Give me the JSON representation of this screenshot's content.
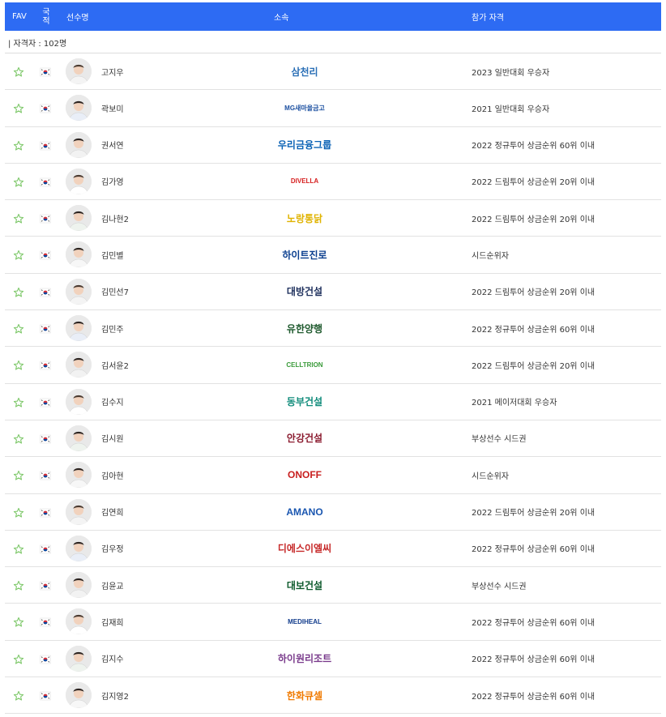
{
  "header": {
    "fav": "FAV",
    "nationality_line1": "국",
    "nationality_line2": "적",
    "player": "선수명",
    "affiliation": "소속",
    "qualification": "참가 자격"
  },
  "count_text": "| 자격자 : 102명",
  "colors": {
    "header_bg": "#2d6bf3",
    "star": "#7ec86a"
  },
  "players": [
    {
      "name": "고지우",
      "affiliation": "삼천리",
      "logo_color": "#2a6fb6",
      "icon": "samchully-logo-icon",
      "qualification": "2023 일반대회 우승자"
    },
    {
      "name": "곽보미",
      "affiliation": "MG새마을금고",
      "logo_color": "#1b4fa0",
      "icon": "mg-logo-icon",
      "qualification": "2021 일반대회 우승자"
    },
    {
      "name": "권서연",
      "affiliation": "우리금융그룹",
      "logo_color": "#0a62b5",
      "icon": "woori-logo-icon",
      "qualification": "2022 정규투어 상금순위 60위 이내"
    },
    {
      "name": "김가영",
      "affiliation": "DIVELLA",
      "logo_color": "#d61f1f",
      "icon": "divella-logo-icon",
      "qualification": "2022 드림투어 상금순위 20위 이내"
    },
    {
      "name": "김나현2",
      "affiliation": "노랑통닭",
      "logo_color": "#e0b300",
      "icon": "norang-logo-icon",
      "qualification": "2022 드림투어 상금순위 20위 이내"
    },
    {
      "name": "김민별",
      "affiliation": "하이트진로",
      "logo_color": "#0b3f8f",
      "icon": "hitejinro-logo-icon",
      "qualification": "시드순위자"
    },
    {
      "name": "김민선7",
      "affiliation": "대방건설",
      "logo_color": "#1d2f5c",
      "icon": "daebang-logo-icon",
      "qualification": "2022 드림투어 상금순위 20위 이내"
    },
    {
      "name": "김민주",
      "affiliation": "유한양행",
      "logo_color": "#1f5a2e",
      "icon": "yuhan-logo-icon",
      "qualification": "2022 정규투어 상금순위 60위 이내"
    },
    {
      "name": "김서윤2",
      "affiliation": "CELLTRION",
      "logo_color": "#3a9b3a",
      "icon": "celltrion-logo-icon",
      "qualification": "2022 드림투어 상금순위 20위 이내"
    },
    {
      "name": "김수지",
      "affiliation": "동부건설",
      "logo_color": "#0f8b7a",
      "icon": "dongbu-logo-icon",
      "qualification": "2021 메이저대회 우승자"
    },
    {
      "name": "김시원",
      "affiliation": "안강건설",
      "logo_color": "#8a1a2e",
      "icon": "angang-logo-icon",
      "qualification": "부상선수 시드권"
    },
    {
      "name": "김아현",
      "affiliation": "ONOFF",
      "logo_color": "#c81e1e",
      "icon": "onoff-logo-icon",
      "qualification": "시드순위자"
    },
    {
      "name": "김연희",
      "affiliation": "AMANO",
      "logo_color": "#1a56b0",
      "icon": "amano-logo-icon",
      "qualification": "2022 드림투어 상금순위 20위 이내"
    },
    {
      "name": "김우정",
      "affiliation": "디에스이엘씨",
      "logo_color": "#c62828",
      "icon": "ds-logo-icon",
      "qualification": "2022 정규투어 상금순위 60위 이내"
    },
    {
      "name": "김윤교",
      "affiliation": "대보건설",
      "logo_color": "#0d5a2c",
      "icon": "daebo-logo-icon",
      "qualification": "부상선수 시드권"
    },
    {
      "name": "김재희",
      "affiliation": "MEDIHEAL",
      "logo_color": "#123c8c",
      "icon": "mediheal-logo-icon",
      "qualification": "2022 정규투어 상금순위 60위 이내"
    },
    {
      "name": "김지수",
      "affiliation": "하이원리조트",
      "logo_color": "#7a3b8c",
      "icon": "high1-logo-icon",
      "qualification": "2022 정규투어 상금순위 60위 이내"
    },
    {
      "name": "김지영2",
      "affiliation": "한화큐셀",
      "logo_color": "#f07a00",
      "icon": "hanwha-logo-icon",
      "qualification": "2022 정규투어 상금순위 60위 이내"
    }
  ]
}
